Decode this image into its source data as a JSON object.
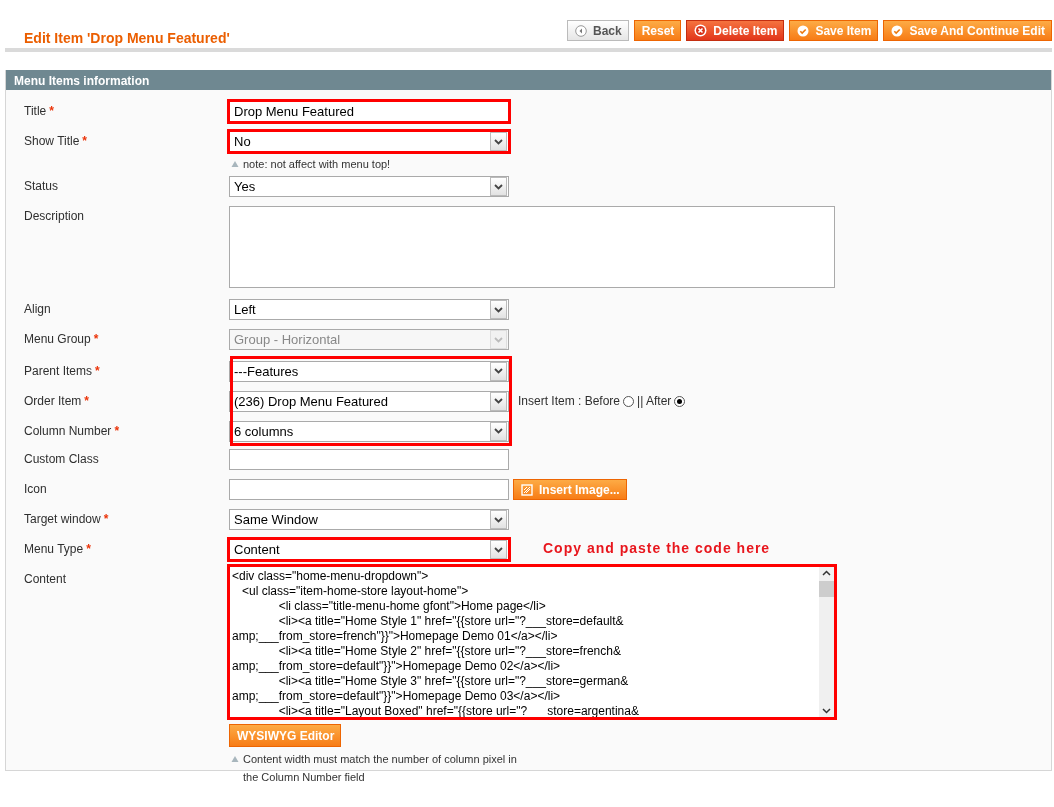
{
  "page_title": "Edit Item 'Drop Menu Featured'",
  "buttons": [
    {
      "label": "Back",
      "kind": "back"
    },
    {
      "label": "Reset",
      "kind": "plain"
    },
    {
      "label": "Delete Item",
      "kind": "delete"
    },
    {
      "label": "Save Item",
      "kind": "save"
    },
    {
      "label": "Save And Continue Edit",
      "kind": "save"
    }
  ],
  "section_title": "Menu Items information",
  "fields": [
    {
      "kind": "text",
      "label": "Title",
      "mark": "*",
      "value": "Drop Menu Featured",
      "highlighted": true
    },
    {
      "kind": "select",
      "label": "Show Title",
      "mark": "*",
      "value": "No",
      "disabled": false,
      "highlighted": true,
      "note": "note: not affect with menu top!"
    },
    {
      "kind": "select",
      "label": "Status",
      "value": "Yes",
      "disabled": false,
      "highlighted": false
    },
    {
      "kind": "textarea",
      "label": "Description",
      "highlighted": false
    },
    {
      "kind": "select",
      "label": "Align",
      "value": "Left",
      "disabled": false,
      "highlighted": false
    },
    {
      "kind": "select",
      "label": "Menu Group",
      "mark": "*",
      "value": "Group - Horizontal",
      "disabled": true,
      "highlighted": false
    },
    {
      "kind": "group",
      "highlighted": true,
      "fields": [
        {
          "kind": "select",
          "label": "Parent Items",
          "mark": "*",
          "value": "---Features",
          "disabled": false,
          "highlighted": false
        },
        {
          "kind": "select",
          "label": "Order Item",
          "mark": "*",
          "value": "(236) Drop Menu Featured",
          "disabled": false,
          "highlighted": false,
          "insert_label": "Insert Item : Before",
          "separator": "|| After",
          "options": [
            {
              "selected": false
            },
            {
              "selected": true
            }
          ]
        },
        {
          "kind": "select",
          "label": "Column Number",
          "mark": "*",
          "value": "6 columns",
          "disabled": false,
          "highlighted": false
        }
      ]
    },
    {
      "kind": "text",
      "label": "Custom Class",
      "highlighted": false
    },
    {
      "kind": "text",
      "label": "Icon",
      "highlighted": false,
      "action": "Insert Image..."
    },
    {
      "kind": "select",
      "label": "Target window",
      "mark": "*",
      "value": "Same Window",
      "disabled": false,
      "highlighted": false
    },
    {
      "kind": "select",
      "label": "Menu Type",
      "mark": "*",
      "value": "Content",
      "disabled": false,
      "highlighted": true,
      "callout": "Copy and paste the code here"
    },
    {
      "kind": "code",
      "label": "Content",
      "highlighted": true,
      "action": "WYSIWYG Editor",
      "note": "Content width must match the number of column pixel in the Column Number field",
      "lines": [
        "<div class=\"home-menu-dropdown\">",
        "   <ul class=\"item-home-store layout-home\">",
        "              <li class=\"title-menu-home gfont\">Home page</li>",
        "              <li><a title=\"Home Style 1\" href=\"{{store url=\"?___store=default&",
        "amp;___from_store=french\"}}\">Homepage Demo 01</a></li>",
        "              <li><a title=\"Home Style 2\" href=\"{{store url=\"?___store=french&",
        "amp;___from_store=default\"}}\">Homepage Demo 02</a></li>",
        "              <li><a title=\"Home Style 3\" href=\"{{store url=\"?___store=german&",
        "amp;___from_store=default\"}}\">Homepage Demo 03</a></li>",
        "              <li><a title=\"Layout Boxed\" href=\"{{store url=\"?      store=argentina&"
      ]
    }
  ]
}
